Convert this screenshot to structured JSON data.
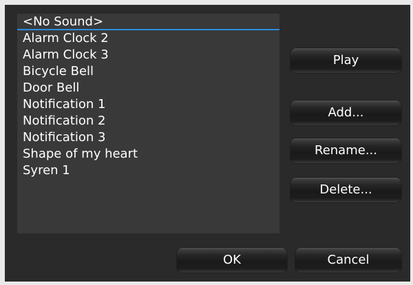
{
  "sound_list": {
    "items": [
      {
        "label": "<No Sound>",
        "selected": true
      },
      {
        "label": "Alarm Clock 2"
      },
      {
        "label": "Alarm Clock 3"
      },
      {
        "label": "Bicycle Bell"
      },
      {
        "label": "Door Bell"
      },
      {
        "label": "Notification 1"
      },
      {
        "label": "Notification 2"
      },
      {
        "label": "Notification 3"
      },
      {
        "label": "Shape of my heart"
      },
      {
        "label": "Syren 1"
      }
    ]
  },
  "buttons": {
    "play": "Play",
    "add": "Add...",
    "rename": "Rename...",
    "delete": "Delete...",
    "ok": "OK",
    "cancel": "Cancel"
  },
  "colors": {
    "dialog_background": "#2a2a2a",
    "list_background": "#393939",
    "selection_underline": "#2c8ee0",
    "text": "#ffffff"
  }
}
